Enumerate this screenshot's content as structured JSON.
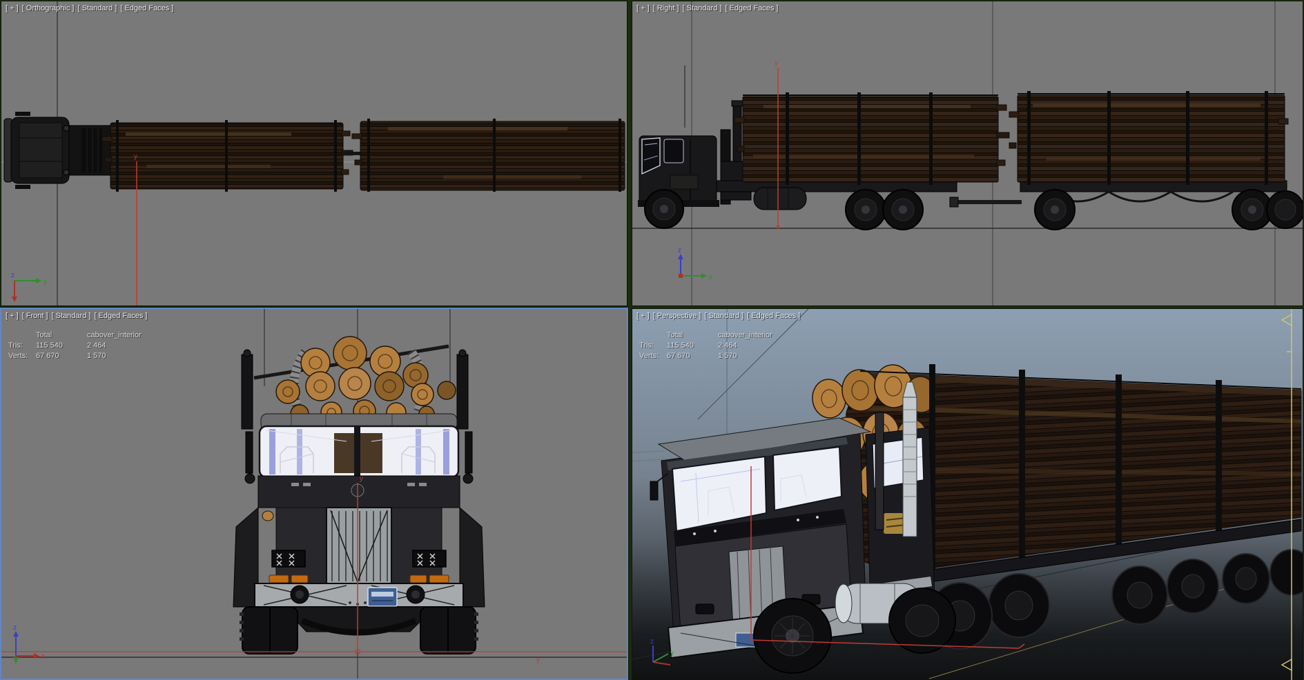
{
  "viewports": {
    "orthographic": {
      "menus": [
        "[ + ]",
        "[ Orthographic ]",
        "[ Standard ]",
        "[ Edged Faces ]"
      ]
    },
    "right": {
      "menus": [
        "[ + ]",
        "[ Right ]",
        "[ Standard ]",
        "[ Edged Faces ]"
      ]
    },
    "front": {
      "menus": [
        "[ + ]",
        "[ Front ]",
        "[ Standard ]",
        "[ Edged Faces ]"
      ]
    },
    "perspective": {
      "menus": [
        "[ + ]",
        "[ Perspective ]",
        "[ Standard ]",
        "[ Edged Faces ]"
      ]
    }
  },
  "statistics": {
    "columns": {
      "total": "Total",
      "object": "cabover_interior"
    },
    "rows": [
      {
        "label": "Tris:",
        "total": "115 540",
        "object": "2 464"
      },
      {
        "label": "Verts:",
        "total": "67 670",
        "object": "1 570"
      }
    ]
  },
  "axes": {
    "x": "x",
    "y": "y",
    "z": "z"
  },
  "colors": {
    "viewport_background": "#797979",
    "active_viewport_border": "#6286c5",
    "divider": "#1d2b11",
    "axis_x_red": "#c23b30",
    "axis_y_green": "#2e8f2e",
    "axis_z_blue": "#3d3dc8",
    "log_end_orange": "#b5803f",
    "perspective_sky_top": "#8d9fb2",
    "edge_widget_yellow": "#d3c468"
  }
}
